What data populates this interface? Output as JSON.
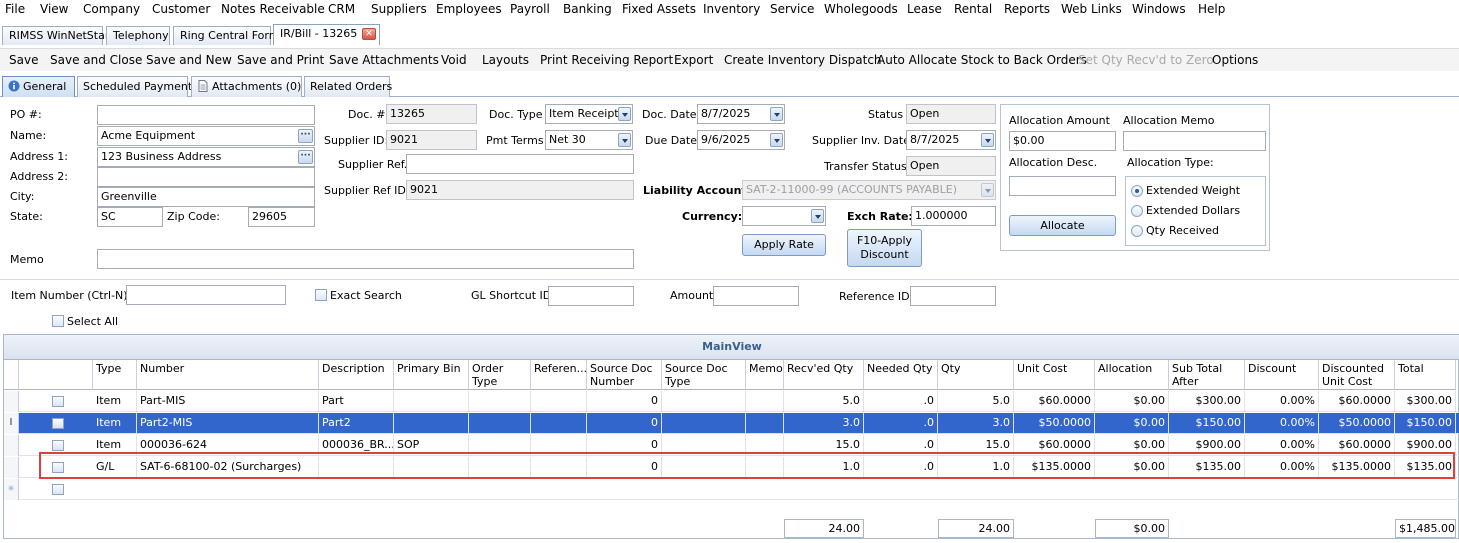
{
  "menu": [
    "File",
    "View",
    "Company",
    "Customer",
    "Notes Receivable",
    "CRM",
    "Suppliers",
    "Employees",
    "Payroll",
    "Banking",
    "Fixed Assets",
    "Inventory",
    "Service",
    "Wholegoods",
    "Lease",
    "Rental",
    "Reports",
    "Web Links",
    "Windows",
    "Help"
  ],
  "window_tabs": [
    "RIMSS WinNetStar",
    "Telephony",
    "Ring Central Form",
    "IR/Bill - 13265"
  ],
  "toolbar": [
    "Save",
    "Save and Close",
    "Save and New",
    "Save and Print",
    "Save Attachments",
    "Void",
    "Layouts",
    "Print Receiving Report",
    "Export",
    "Create Inventory Dispatch",
    "Auto Allocate Stock to Back Orders",
    "Set Qty Recv'd to Zero",
    "Options"
  ],
  "sub_tabs": [
    "General",
    "Scheduled Payments",
    "Attachments (0)",
    "Related Orders"
  ],
  "form": {
    "po_label": "PO #:",
    "po_value": "",
    "name_label": "Name:",
    "name_value": "Acme Equipment",
    "addr1_label": "Address 1:",
    "addr1_value": "123 Business Address",
    "addr2_label": "Address 2:",
    "addr2_value": "",
    "city_label": "City:",
    "city_value": "Greenville",
    "state_label": "State:",
    "state_value": "SC",
    "zip_label": "Zip Code:",
    "zip_value": "29605",
    "memo_label": "Memo",
    "memo_value": "",
    "doc_no_label": "Doc. #",
    "doc_no_value": "13265",
    "supplier_id_label": "Supplier ID:",
    "supplier_id_value": "9021",
    "supplier_ref_label": "Supplier Ref.",
    "supplier_ref_value": "",
    "supplier_ref_id_label": "Supplier Ref ID:",
    "supplier_ref_id_value": "9021",
    "doc_type_label": "Doc. Type",
    "doc_type_value": "Item Receipt",
    "pmt_terms_label": "Pmt Terms",
    "pmt_terms_value": "Net 30",
    "doc_date_label": "Doc. Date",
    "doc_date_value": "8/7/2025",
    "due_date_label": "Due Date",
    "due_date_value": "9/6/2025",
    "status_label": "Status",
    "status_value": "Open",
    "sup_inv_date_label": "Supplier Inv. Date",
    "sup_inv_date_value": "8/7/2025",
    "transfer_status_label": "Transfer Status",
    "transfer_status_value": "Open",
    "liability_label": "Liability Account",
    "liability_value": "SAT-2-11000-99 (ACCOUNTS PAYABLE)",
    "currency_label": "Currency:",
    "currency_value": "",
    "exch_rate_label": "Exch Rate:",
    "exch_rate_value": "1.000000",
    "apply_rate_label": "Apply Rate",
    "f10_line1": "F10-Apply",
    "f10_line2": "Discount"
  },
  "allocation": {
    "amount_label": "Allocation Amount",
    "amount_value": "$0.00",
    "memo_label": "Allocation Memo",
    "memo_value": "",
    "desc_label": "Allocation Desc.",
    "desc_value": "",
    "type_label": "Allocation Type:",
    "allocate_label": "Allocate",
    "types": [
      {
        "label": "Extended Weight",
        "selected": true
      },
      {
        "label": "Extended Dollars",
        "selected": false
      },
      {
        "label": "Qty Received",
        "selected": false
      }
    ]
  },
  "search": {
    "item_number_label": "Item Number (Ctrl-N):",
    "exact_search_label": "Exact Search",
    "gl_shortcut_label": "GL Shortcut ID",
    "amount_label": "Amount",
    "reference_id_label": "Reference ID",
    "select_all_label": "Select All"
  },
  "grid": {
    "caption": "MainView",
    "columns": [
      "Type",
      "Number",
      "Description",
      "Primary Bin",
      "Order Type",
      "Referen...",
      "Source Doc Number",
      "Source Doc Type",
      "Memo",
      "Recv'ed Qty",
      "Needed Qty",
      "Qty",
      "Unit Cost",
      "Allocation",
      "Sub Total After Alloca...",
      "Discount",
      "Discounted Unit Cost",
      "Total"
    ],
    "rows": [
      {
        "type": "Item",
        "number": "Part-MIS",
        "description": "Part",
        "primary_bin": "",
        "order_type": "",
        "reference": "",
        "source_doc_number": "0",
        "source_doc_type": "",
        "memo": "",
        "recvd_qty": "5.0",
        "needed_qty": ".0",
        "qty": "5.0",
        "unit_cost": "$60.0000",
        "allocation": "$0.00",
        "sub_total": "$300.00",
        "discount": "0.00%",
        "disc_unit_cost": "$60.0000",
        "total": "$300.00",
        "selected": false
      },
      {
        "type": "Item",
        "number": "Part2-MIS",
        "description": "Part2",
        "primary_bin": "",
        "order_type": "",
        "reference": "",
        "source_doc_number": "0",
        "source_doc_type": "",
        "memo": "",
        "recvd_qty": "3.0",
        "needed_qty": ".0",
        "qty": "3.0",
        "unit_cost": "$50.0000",
        "allocation": "$0.00",
        "sub_total": "$150.00",
        "discount": "0.00%",
        "disc_unit_cost": "$50.0000",
        "total": "$150.00",
        "selected": true
      },
      {
        "type": "Item",
        "number": "000036-624",
        "description": "000036_BR...",
        "primary_bin": "SOP",
        "order_type": "",
        "reference": "",
        "source_doc_number": "0",
        "source_doc_type": "",
        "memo": "",
        "recvd_qty": "15.0",
        "needed_qty": ".0",
        "qty": "15.0",
        "unit_cost": "$60.0000",
        "allocation": "$0.00",
        "sub_total": "$900.00",
        "discount": "0.00%",
        "disc_unit_cost": "$60.0000",
        "total": "$900.00",
        "selected": false
      },
      {
        "type": "G/L",
        "number": "SAT-6-68100-02 (Surcharges)",
        "description": "",
        "primary_bin": "",
        "order_type": "",
        "reference": "",
        "source_doc_number": "0",
        "source_doc_type": "",
        "memo": "",
        "recvd_qty": "1.0",
        "needed_qty": ".0",
        "qty": "1.0",
        "unit_cost": "$135.0000",
        "allocation": "$0.00",
        "sub_total": "$135.00",
        "discount": "0.00%",
        "disc_unit_cost": "$135.0000",
        "total": "$135.00",
        "selected": false
      }
    ],
    "totals": {
      "recvd_qty": "24.00",
      "qty": "24.00",
      "allocation": "$0.00",
      "total": "$1,485.00"
    }
  }
}
